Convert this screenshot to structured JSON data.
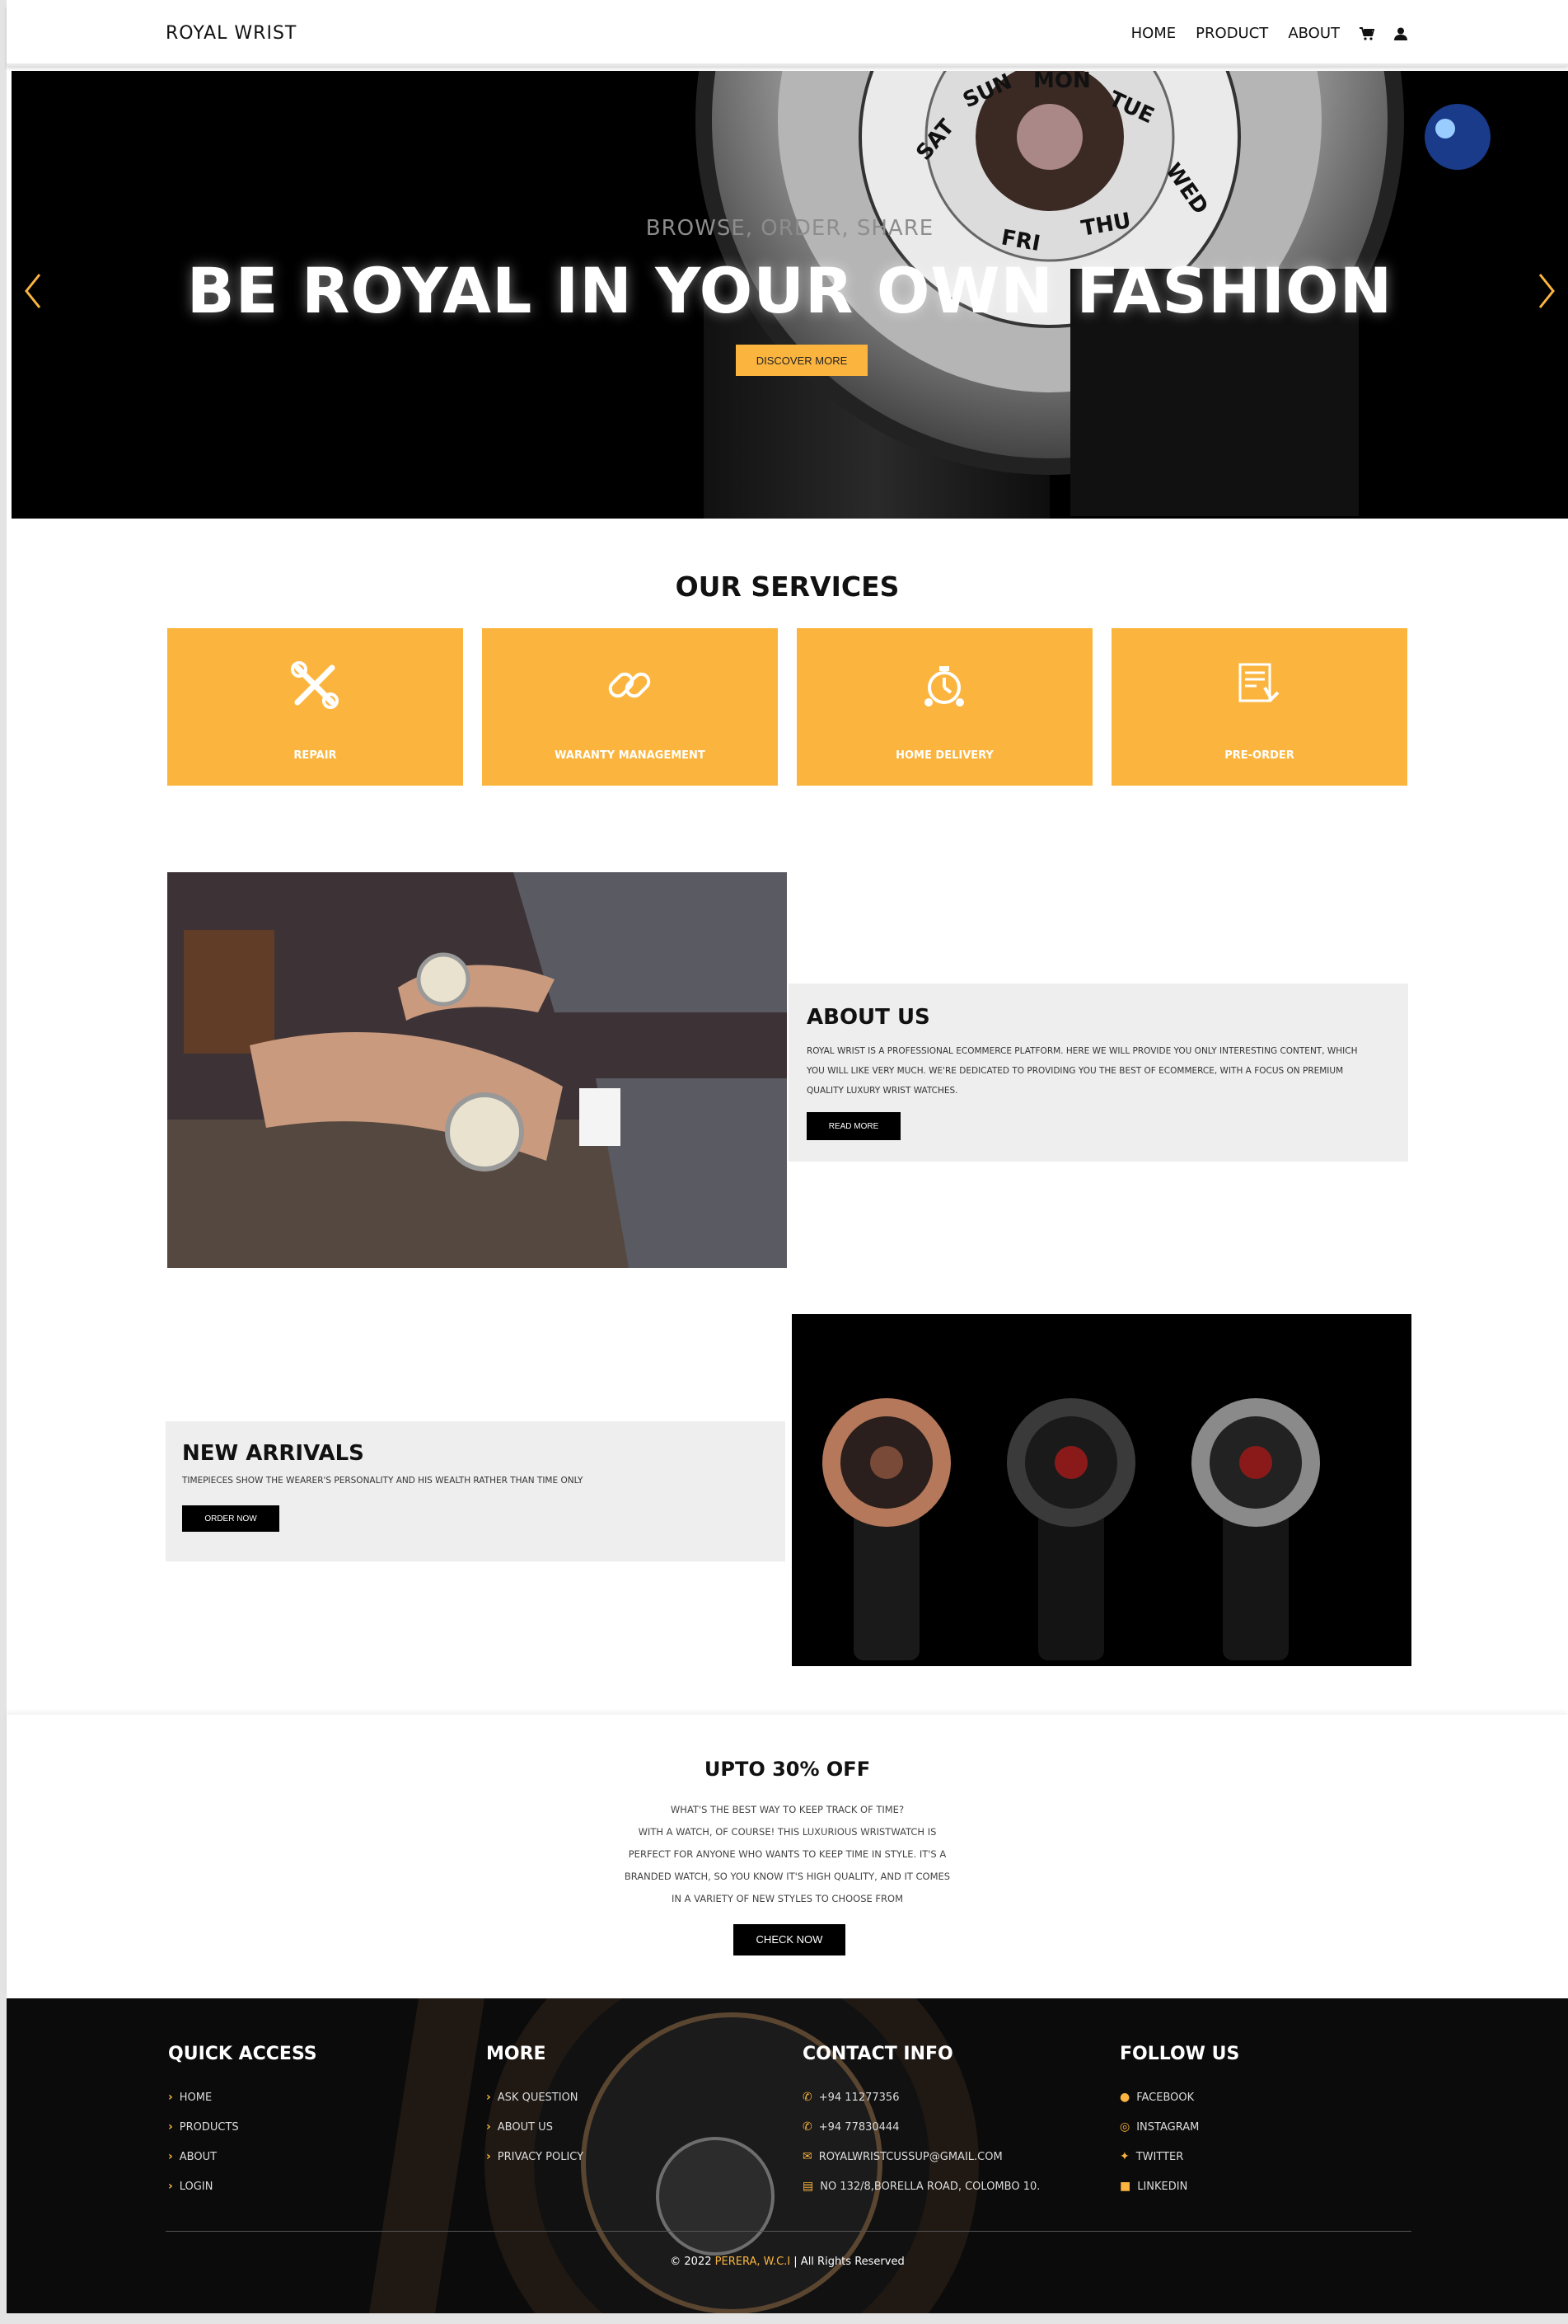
{
  "nav": {
    "brand": "ROYAL WRIST",
    "links": [
      "HOME",
      "PRODUCT",
      "ABOUT"
    ],
    "icons": [
      "cart-icon",
      "user-icon"
    ]
  },
  "hero": {
    "subtitle": "BROWSE, ORDER, SHARE",
    "title": "BE ROYAL IN YOUR OWN FASHION",
    "button": "DISCOVER MORE"
  },
  "services": {
    "title": "OUR SERVICES",
    "items": [
      {
        "label": "REPAIR",
        "icon": "tools-icon"
      },
      {
        "label": "WARANTY MANAGEMENT",
        "icon": "link-icon"
      },
      {
        "label": "HOME DELIVERY",
        "icon": "delivery-icon"
      },
      {
        "label": "PRE-ORDER",
        "icon": "preorder-icon"
      }
    ]
  },
  "about": {
    "title": "ABOUT US",
    "lines": [
      "ROYAL WRIST IS A PROFESSIONAL ECOMMERCE PLATFORM. HERE WE WILL PROVIDE YOU ONLY INTERESTING CONTENT, WHICH",
      "YOU WILL LIKE VERY MUCH. WE'RE DEDICATED TO PROVIDING YOU THE BEST OF ECOMMERCE, WITH A FOCUS ON PREMIUM",
      "QUALITY LUXURY WRIST WATCHES."
    ],
    "button": "READ MORE"
  },
  "arrivals": {
    "title": "NEW ARRIVALS",
    "text": "TIMEPIECES SHOW THE WEARER'S PERSONALITY AND HIS WEALTH RATHER THAN TIME ONLY",
    "button": "ORDER NOW"
  },
  "offer": {
    "title": "UPTO 30% OFF",
    "lines": [
      "WHAT'S THE BEST WAY TO KEEP TRACK OF TIME?",
      "WITH A WATCH, OF COURSE! THIS LUXURIOUS WRISTWATCH IS",
      "PERFECT FOR ANYONE WHO WANTS TO KEEP TIME IN STYLE. IT'S A",
      "BRANDED WATCH, SO YOU KNOW IT'S HIGH QUALITY, AND IT COMES",
      "IN A VARIETY OF NEW STYLES TO CHOOSE FROM"
    ],
    "button": "CHECK NOW"
  },
  "footer": {
    "quick": {
      "title": "QUICK ACCESS",
      "items": [
        "HOME",
        "PRODUCTS",
        "ABOUT",
        "LOGIN"
      ]
    },
    "more": {
      "title": "MORE",
      "items": [
        "ASK QUESTION",
        "ABOUT US",
        "PRIVACY POLICY"
      ]
    },
    "contact": {
      "title": "CONTACT INFO",
      "items": [
        {
          "text": "+94 11277356",
          "icon": "phone-icon"
        },
        {
          "text": "+94 77830444",
          "icon": "phone-icon"
        },
        {
          "text": "ROYALWRISTCUSSUP@GMAIL.COM",
          "icon": "mail-icon"
        },
        {
          "text": "NO 132/8,BORELLA ROAD, COLOMBO 10.",
          "icon": "map-icon"
        }
      ]
    },
    "follow": {
      "title": "FOLLOW US",
      "items": [
        {
          "text": "FACEBOOK",
          "icon": "facebook-icon"
        },
        {
          "text": "INSTAGRAM",
          "icon": "instagram-icon"
        },
        {
          "text": "TWITTER",
          "icon": "twitter-icon"
        },
        {
          "text": "LINKEDIN",
          "icon": "linkedin-icon"
        }
      ]
    },
    "copy_prefix": "© 2022 ",
    "copy_name": "PERERA, W.C.I",
    "copy_suffix": " | All Rights Reserved"
  },
  "colors": {
    "accent": "#fbb53f",
    "dark": "#000000",
    "panel": "#eeeeee"
  }
}
